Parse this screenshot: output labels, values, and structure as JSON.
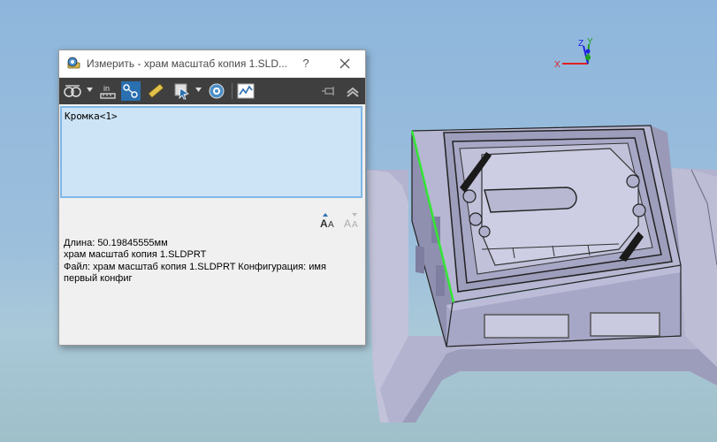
{
  "dialog": {
    "title": "Измерить - храм масштаб копия 1.SLD...",
    "help_label": "?",
    "toolbar": {
      "icons": [
        "arc-circle-measure-icon",
        "units-precision-icon",
        "point-to-point-icon",
        "xyz-measure-icon",
        "projection-icon",
        "show-history-icon",
        "create-sensor-icon",
        "pin-icon",
        "collapse-icon"
      ]
    },
    "selection": {
      "items": [
        "Кромка<1>"
      ]
    },
    "results": {
      "length": "Длина: 50.19845555мм",
      "part": "храм масштаб копия 1.SLDPRT",
      "file_line1": "Файл: храм масштаб копия 1.SLDPRT Конфигурация: имя",
      "file_line2": "первый конфиг"
    }
  },
  "triad": {
    "x_label": "X",
    "y_label": "Y",
    "z_label": "Z"
  },
  "colors": {
    "selected_edge": "#33e633",
    "model_face": "#a9a9c4",
    "toolbar_bg": "#3f3f3f",
    "selection_bg": "#cde4f7",
    "selection_border": "#7fb7e6"
  }
}
